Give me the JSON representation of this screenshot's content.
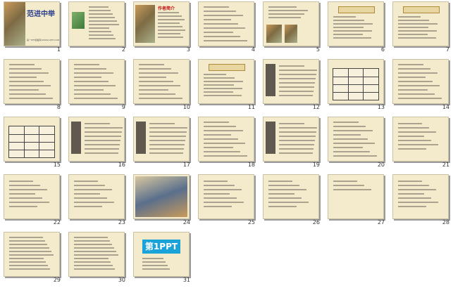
{
  "thumbnails": [
    {
      "num": "1",
      "title": "范进中举",
      "caption": "第一PPT模板网-WWW.1PPT.COM"
    },
    {
      "num": "2",
      "title": ""
    },
    {
      "num": "3",
      "title": "作者简介"
    },
    {
      "num": "4",
      "title": ""
    },
    {
      "num": "5",
      "title": ""
    },
    {
      "num": "6",
      "title": ""
    },
    {
      "num": "7",
      "title": ""
    },
    {
      "num": "8",
      "title": ""
    },
    {
      "num": "9",
      "title": ""
    },
    {
      "num": "10",
      "title": ""
    },
    {
      "num": "11",
      "title": ""
    },
    {
      "num": "12",
      "title": ""
    },
    {
      "num": "13",
      "title": ""
    },
    {
      "num": "14",
      "title": ""
    },
    {
      "num": "15",
      "title": ""
    },
    {
      "num": "16",
      "title": ""
    },
    {
      "num": "17",
      "title": ""
    },
    {
      "num": "18",
      "title": ""
    },
    {
      "num": "19",
      "title": ""
    },
    {
      "num": "20",
      "title": ""
    },
    {
      "num": "21",
      "title": ""
    },
    {
      "num": "22",
      "title": ""
    },
    {
      "num": "23",
      "title": ""
    },
    {
      "num": "24",
      "title": ""
    },
    {
      "num": "25",
      "title": ""
    },
    {
      "num": "26",
      "title": ""
    },
    {
      "num": "27",
      "title": ""
    },
    {
      "num": "28",
      "title": ""
    },
    {
      "num": "29",
      "title": ""
    },
    {
      "num": "30",
      "title": ""
    },
    {
      "num": "31",
      "title": "第1PPT"
    }
  ],
  "colors": {
    "slide_bg": "#f3ebcb",
    "title_blue": "#2a3d8c",
    "accent_red": "#c21616",
    "logo_blue": "#1aa3d8"
  }
}
